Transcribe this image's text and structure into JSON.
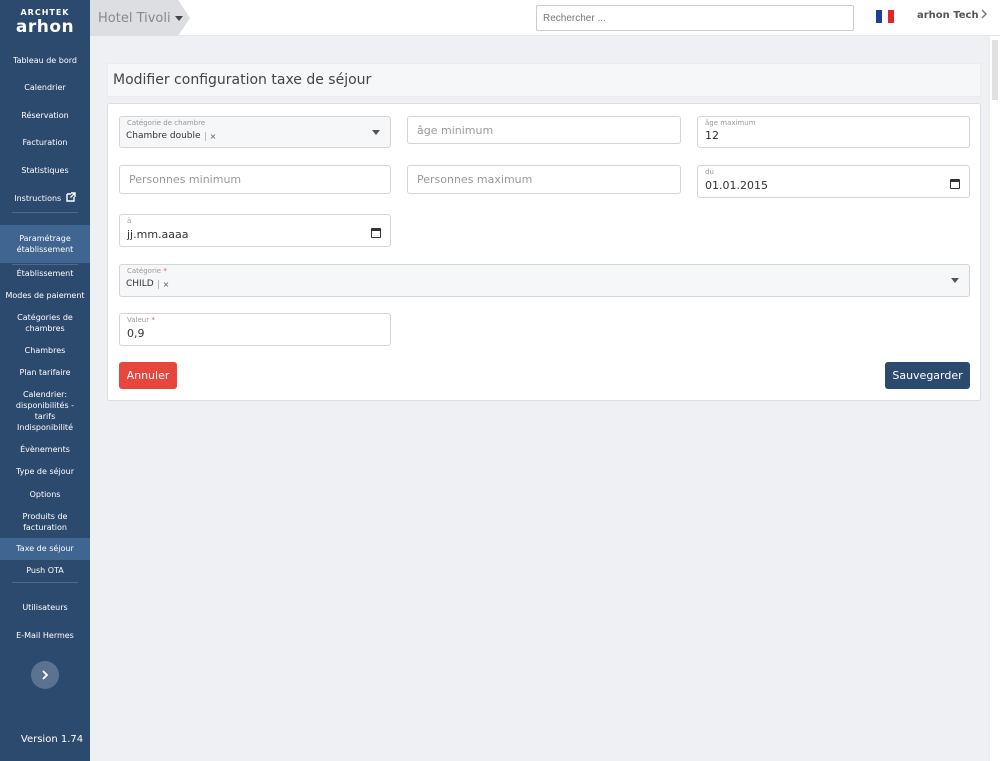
{
  "brand": {
    "top": "ARCHTEK",
    "main": "arhon"
  },
  "sidebar": {
    "items": [
      {
        "label": "Tableau de bord"
      },
      {
        "label": "Calendrier"
      },
      {
        "label": "Réservation"
      },
      {
        "label": "Facturation"
      },
      {
        "label": "Statistiques"
      },
      {
        "label": "Instructions"
      },
      {
        "label": "Paramétrage établissement"
      },
      {
        "label": "Établissement"
      },
      {
        "label": "Modes de paiement"
      },
      {
        "label": "Catégories de chambres"
      },
      {
        "label": "Chambres"
      },
      {
        "label": "Plan tarifaire"
      },
      {
        "label": "Calendrier: disponibilités - tarifs"
      },
      {
        "label": "Indisponibilité"
      },
      {
        "label": "Évènements"
      },
      {
        "label": "Type de séjour"
      },
      {
        "label": "Options"
      },
      {
        "label": "Produits de facturation"
      },
      {
        "label": "Taxe de séjour"
      },
      {
        "label": "Push OTA"
      },
      {
        "label": "Utilisateurs"
      },
      {
        "label": "E-Mail Hermes"
      }
    ],
    "version": "Version 1.74"
  },
  "topbar": {
    "hotel": "Hotel Tivoli",
    "search_placeholder": "Rechercher ...",
    "user": "arhon Tech"
  },
  "page": {
    "title": "Modifier configuration taxe de séjour"
  },
  "form": {
    "room_category": {
      "label": "Catégorie de chambre",
      "value": "Chambre double"
    },
    "age_min": {
      "placeholder": "âge minimum"
    },
    "age_max": {
      "label": "âge maximum",
      "value": "12"
    },
    "persons_min": {
      "placeholder": "Personnes minimum"
    },
    "persons_max": {
      "placeholder": "Personnes maximum"
    },
    "date_from": {
      "label": "du",
      "value": "01.01.2015"
    },
    "date_to": {
      "label": "à",
      "value": "jj.mm.aaaa"
    },
    "category": {
      "label": "Catégorie",
      "required": "*",
      "value": "CHILD"
    },
    "value": {
      "label": "Valeur",
      "required": "*",
      "value": "0,9"
    },
    "remove_symbol": "×",
    "cancel_label": "Annuler",
    "save_label": "Sauvegarder"
  },
  "colors": {
    "sidebar_bg": "#2c4a6e",
    "sidebar_active": "#3f6590",
    "cancel": "#e8453c",
    "save": "#2c4a6e",
    "flag": [
      "#1f3f9c",
      "#ffffff",
      "#e3242b"
    ]
  },
  "icons": {
    "external_link": "external-link-icon",
    "caret": "caret-down-icon",
    "chevron": "chevron-right-icon",
    "calendar": "calendar-icon",
    "flag": "flag-france-icon"
  }
}
